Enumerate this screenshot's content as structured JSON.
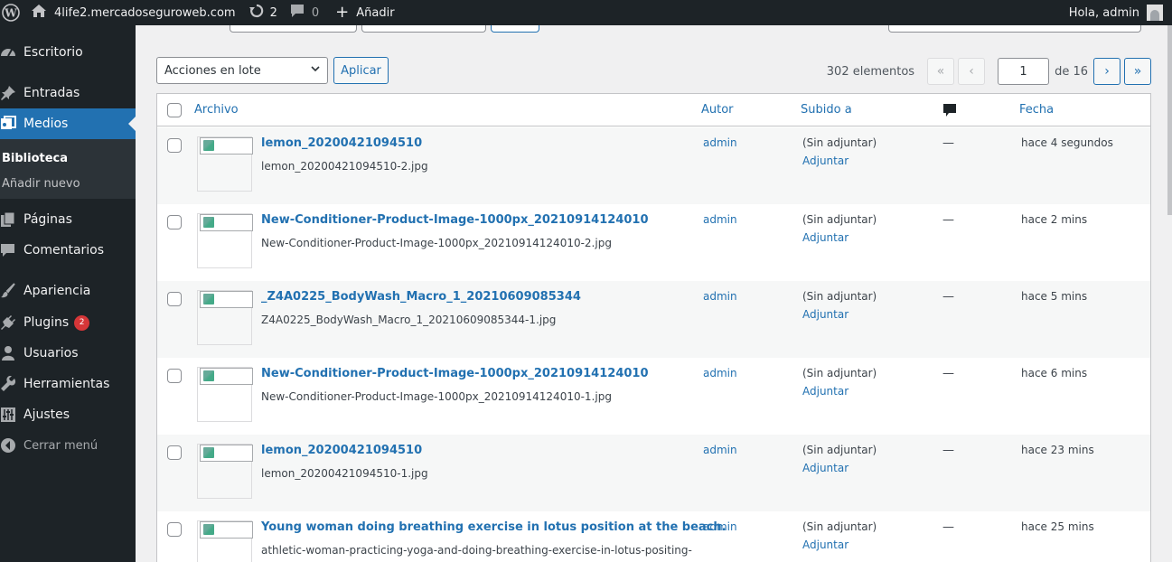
{
  "adminbar": {
    "site_name": "4life2.mercadoseguroweb.com",
    "updates_count": "2",
    "comments_count": "0",
    "new_label": "Añadir",
    "greeting": "Hola, admin"
  },
  "sidebar": {
    "items": [
      {
        "label": "Escritorio",
        "icon": "dashboard-icon"
      },
      {
        "label": "Entradas",
        "icon": "pin-icon"
      },
      {
        "label": "Medios",
        "icon": "media-icon"
      },
      {
        "label": "Páginas",
        "icon": "page-icon"
      },
      {
        "label": "Comentarios",
        "icon": "comment-icon"
      },
      {
        "label": "Apariencia",
        "icon": "brush-icon"
      },
      {
        "label": "Plugins",
        "icon": "plugin-icon",
        "badge": "2"
      },
      {
        "label": "Usuarios",
        "icon": "user-icon"
      },
      {
        "label": "Herramientas",
        "icon": "wrench-icon"
      },
      {
        "label": "Ajustes",
        "icon": "settings-icon"
      }
    ],
    "submenu": [
      {
        "label": "Biblioteca"
      },
      {
        "label": "Añadir nuevo"
      }
    ],
    "collapse_label": "Cerrar menú"
  },
  "toolbar": {
    "bulk_action": "Acciones en lote",
    "apply_label": "Aplicar"
  },
  "pagination": {
    "count": "302 elementos",
    "first": "«",
    "prev": "‹",
    "current_page": "1",
    "of_total": "de 16",
    "next": "›",
    "last": "»"
  },
  "table": {
    "headers": {
      "file": "Archivo",
      "author": "Autor",
      "uploaded_to": "Subido a",
      "date": "Fecha"
    },
    "rows": [
      {
        "title": "lemon_20200421094510",
        "filename": "lemon_20200421094510-2.jpg",
        "author": "admin",
        "uploaded_to": "(Sin adjuntar)",
        "attach": "Adjuntar",
        "comments": "—",
        "date": "hace 4 segundos"
      },
      {
        "title": "New-Conditioner-Product-Image-1000px_20210914124010",
        "filename": "New-Conditioner-Product-Image-1000px_20210914124010-2.jpg",
        "author": "admin",
        "uploaded_to": "(Sin adjuntar)",
        "attach": "Adjuntar",
        "comments": "—",
        "date": "hace 2 mins"
      },
      {
        "title": "_Z4A0225_BodyWash_Macro_1_20210609085344",
        "filename": "Z4A0225_BodyWash_Macro_1_20210609085344-1.jpg",
        "author": "admin",
        "uploaded_to": "(Sin adjuntar)",
        "attach": "Adjuntar",
        "comments": "—",
        "date": "hace 5 mins"
      },
      {
        "title": "New-Conditioner-Product-Image-1000px_20210914124010",
        "filename": "New-Conditioner-Product-Image-1000px_20210914124010-1.jpg",
        "author": "admin",
        "uploaded_to": "(Sin adjuntar)",
        "attach": "Adjuntar",
        "comments": "—",
        "date": "hace 6 mins"
      },
      {
        "title": "lemon_20200421094510",
        "filename": "lemon_20200421094510-1.jpg",
        "author": "admin",
        "uploaded_to": "(Sin adjuntar)",
        "attach": "Adjuntar",
        "comments": "—",
        "date": "hace 23 mins"
      },
      {
        "title": "Young woman doing breathing exercise in lotus position at the beach.",
        "filename": "athletic-woman-practicing-yoga-and-doing-breathing-exercise-in-lotus-positing-",
        "author": "admin",
        "uploaded_to": "(Sin adjuntar)",
        "attach": "Adjuntar",
        "comments": "—",
        "date": "hace 25 mins"
      }
    ]
  }
}
